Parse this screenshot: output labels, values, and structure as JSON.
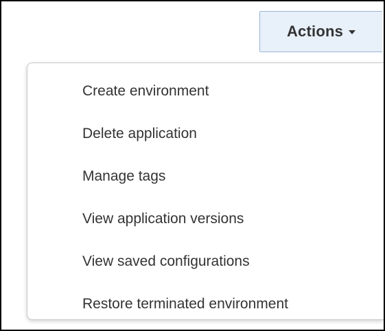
{
  "actions_button": {
    "label": "Actions",
    "icon": "caret-down-icon"
  },
  "menu": {
    "items": [
      {
        "label": "Create environment"
      },
      {
        "label": "Delete application"
      },
      {
        "label": "Manage tags"
      },
      {
        "label": "View application versions"
      },
      {
        "label": "View saved configurations"
      },
      {
        "label": "Restore terminated environment"
      }
    ]
  },
  "colors": {
    "button_background": "#e8f0fa",
    "button_border": "#9bb6d6",
    "text": "#333333",
    "menu_border": "#c8c8c8",
    "frame_border": "#000000"
  }
}
